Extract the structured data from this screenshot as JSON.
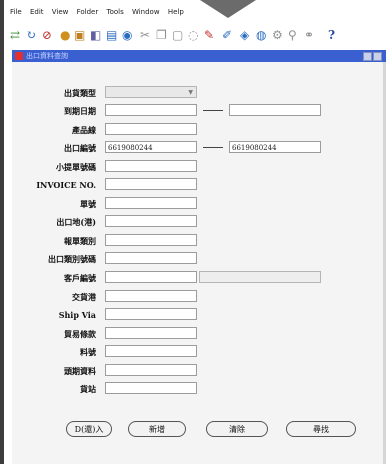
{
  "menu": [
    "File",
    "Edit",
    "View",
    "Folder",
    "Tools",
    "Window",
    "Help"
  ],
  "toolbar_icons": [
    "open-icon",
    "refresh-icon",
    "cancel-icon",
    "lock-icon",
    "folder-icon",
    "copy-icon",
    "print-icon",
    "save-icon",
    "cut-icon",
    "paste-icon",
    "undo-icon",
    "redo-icon",
    "attach-icon",
    "translate-icon",
    "bookmark-icon",
    "world-icon",
    "info-icon",
    "tool-icon",
    "zoom-icon",
    "help-icon"
  ],
  "window": {
    "title": "出口資料查詢"
  },
  "form": {
    "labels": [
      "出貨類型",
      "到期日期",
      "產品線",
      "出口編號",
      "小提單號碼",
      "INVOICE NO.",
      "單號",
      "出口地(港)",
      "報單類別",
      "出口類別號碼",
      "客戶編號",
      "交貨港",
      "Ship Via",
      "貿易條款",
      "料號",
      "頭期資料",
      "貨站"
    ],
    "export_no_from": "6619080244",
    "export_no_to": "6619080244"
  },
  "buttons": {
    "b1": "D(還)入",
    "b2": "新增",
    "b3": "清除",
    "b4": "尋找"
  }
}
